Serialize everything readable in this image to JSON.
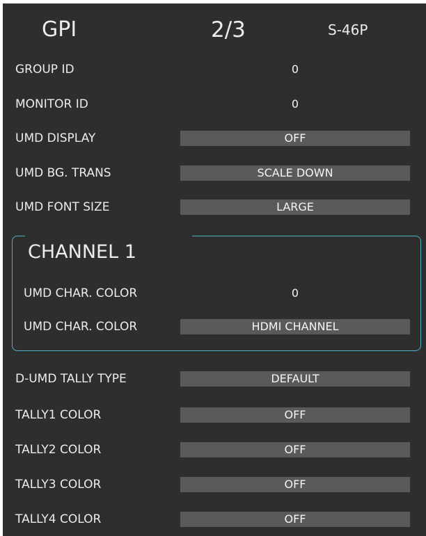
{
  "header": {
    "title": "GPI",
    "page": "2/3",
    "model": "S-46P"
  },
  "rows": [
    {
      "label": "GROUP ID",
      "value": "0"
    },
    {
      "label": "MONITOR ID",
      "value": "0"
    },
    {
      "label": "UMD DISPLAY",
      "value": "OFF"
    },
    {
      "label": "UMD BG. TRANS",
      "value": "SCALE DOWN"
    },
    {
      "label": "UMD FONT SIZE",
      "value": "LARGE"
    }
  ],
  "channel": {
    "title": "CHANNEL 1",
    "rows": [
      {
        "label": "UMD CHAR. COLOR",
        "value": "0"
      },
      {
        "label": "UMD CHAR. COLOR",
        "value": "HDMI CHANNEL"
      }
    ]
  },
  "tally": [
    {
      "label": "D-UMD TALLY TYPE",
      "value": "DEFAULT"
    },
    {
      "label": "TALLY1 COLOR",
      "value": "OFF"
    },
    {
      "label": "TALLY2 COLOR",
      "value": "OFF"
    },
    {
      "label": "TALLY3 COLOR",
      "value": "OFF"
    },
    {
      "label": "TALLY4 COLOR",
      "value": "OFF"
    }
  ],
  "colors": {
    "panel_background": "#2e2e2e",
    "value_box": "#5a5a5a",
    "group_border": "#4fb2c7",
    "text": "#ececec"
  }
}
